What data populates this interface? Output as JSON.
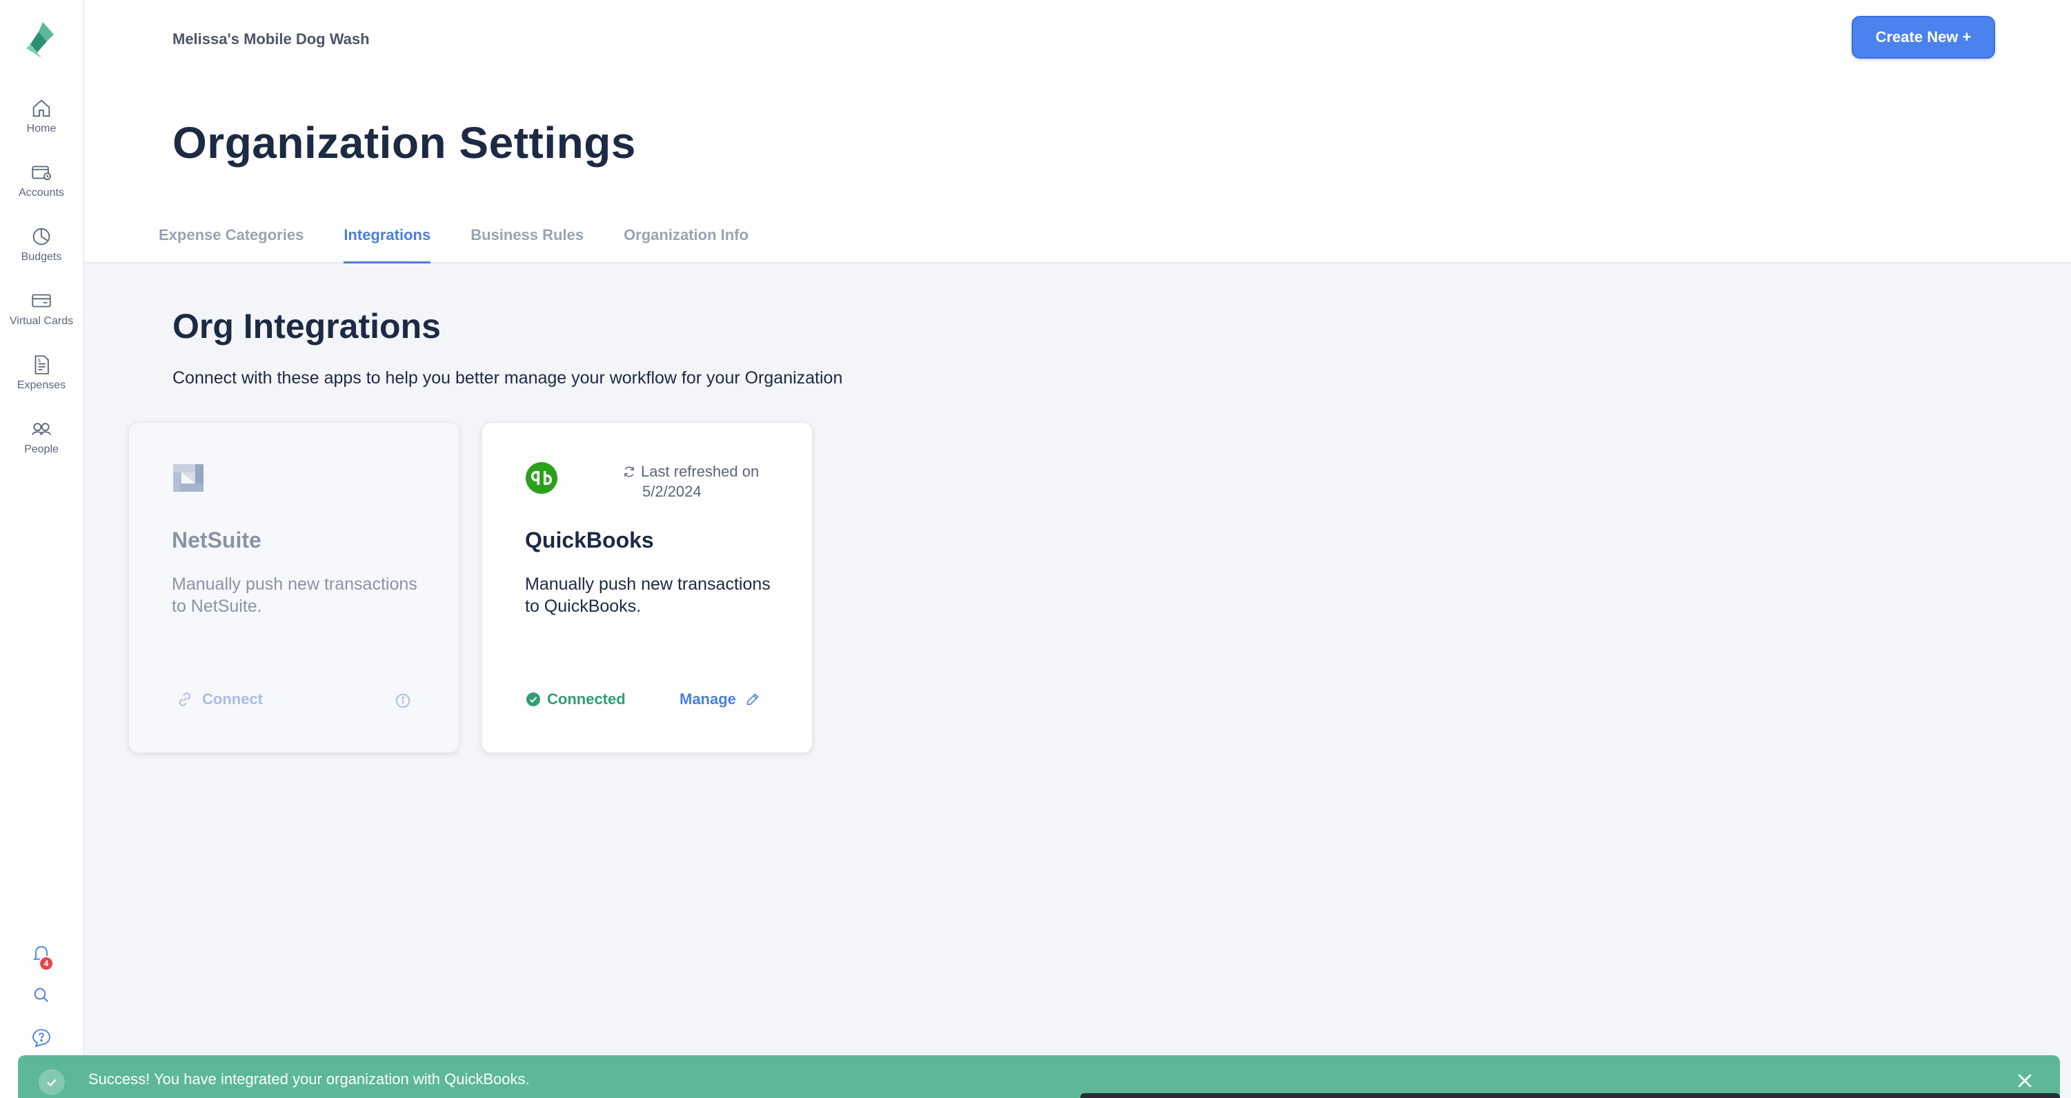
{
  "org": {
    "name": "Melissa's Mobile Dog Wash"
  },
  "header": {
    "create_label": "Create New +"
  },
  "page": {
    "title": "Organization Settings"
  },
  "tabs": [
    {
      "label": "Expense Categories",
      "active": false
    },
    {
      "label": "Integrations",
      "active": true
    },
    {
      "label": "Business Rules",
      "active": false
    },
    {
      "label": "Organization Info",
      "active": false
    }
  ],
  "sidebar": {
    "items": [
      {
        "label": "Home",
        "icon": "home-icon"
      },
      {
        "label": "Accounts",
        "icon": "accounts-icon"
      },
      {
        "label": "Budgets",
        "icon": "budgets-icon"
      },
      {
        "label": "Virtual Cards",
        "icon": "card-icon"
      },
      {
        "label": "Expenses",
        "icon": "expenses-icon"
      },
      {
        "label": "People",
        "icon": "people-icon"
      }
    ],
    "notification_count": "4"
  },
  "section": {
    "title": "Org Integrations",
    "description": "Connect with these apps to help you better manage your workflow for your Organization"
  },
  "integrations": [
    {
      "name": "NetSuite",
      "description": "Manually push new transactions to NetSuite.",
      "action_label": "Connect",
      "enabled": false
    },
    {
      "name": "QuickBooks",
      "description": "Manually push new transactions to QuickBooks.",
      "refresh_label": "Last refreshed on",
      "refresh_date": "5/2/2024",
      "status_label": "Connected",
      "manage_label": "Manage"
    }
  ],
  "toast": {
    "message": "Success! You have integrated your organization with QuickBooks."
  },
  "colors": {
    "accent": "#4b82ee",
    "success": "#5cb896",
    "title": "#1d2a44",
    "quickbooks": "#2ca01c"
  }
}
